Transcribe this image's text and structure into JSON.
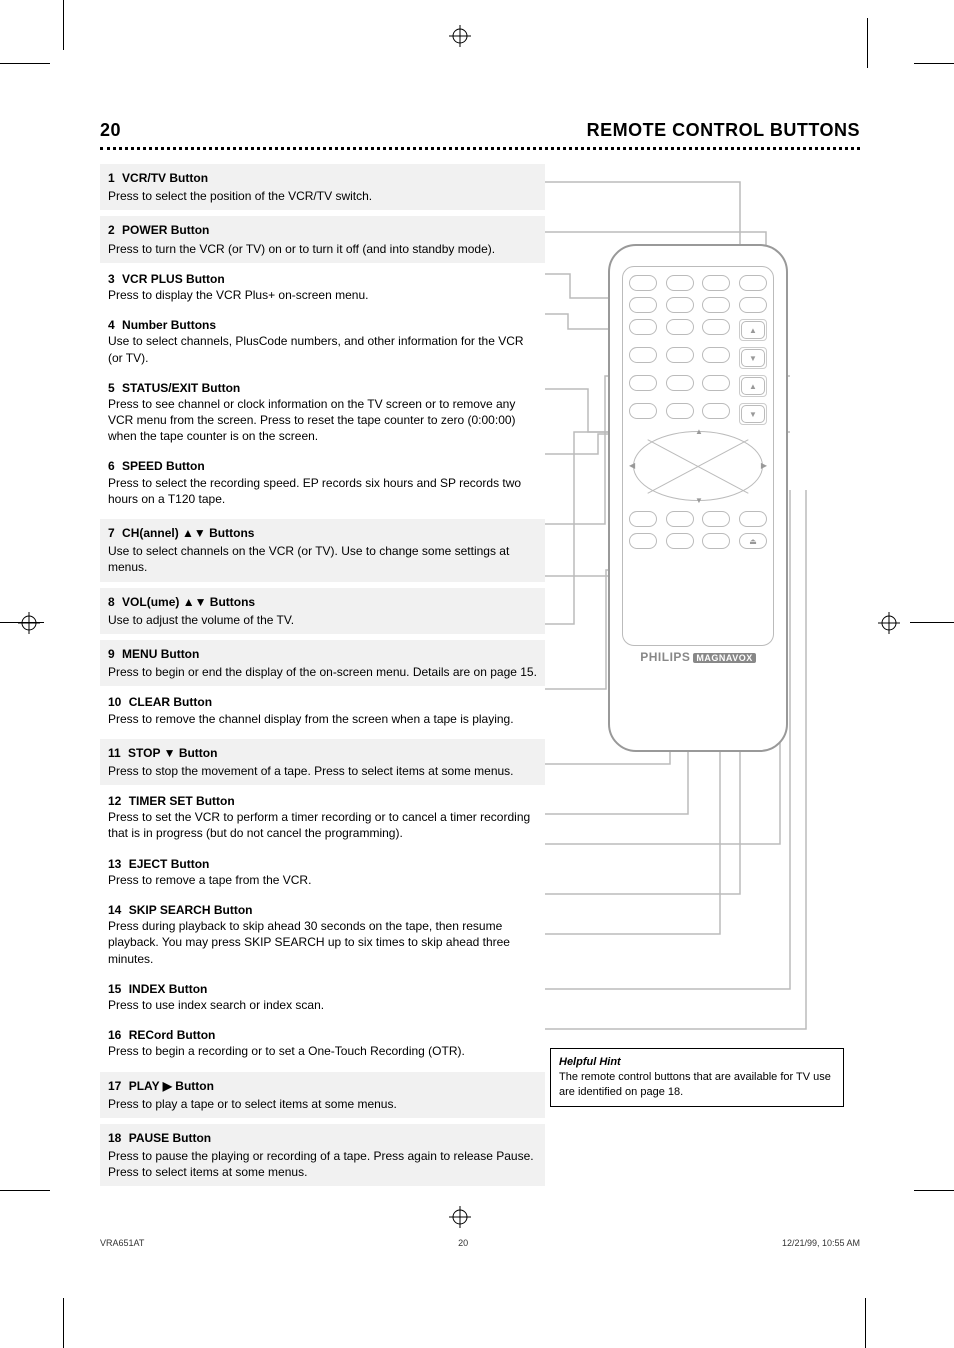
{
  "header": {
    "left": "20",
    "right": "REMOTE CONTROL BUTTONS"
  },
  "rows": [
    {
      "n": "1",
      "label": "VCR/TV Button",
      "desc": "Press to select the position of the VCR/TV switch."
    },
    {
      "n": "2",
      "label": "POWER Button",
      "desc": "Press to turn the VCR (or TV) on or to turn it off (and into standby mode)."
    },
    {
      "n": "3",
      "label": "VCR PLUS Button",
      "desc": "Press to display the VCR Plus+ on-screen menu."
    },
    {
      "n": "4",
      "label": "Number Buttons",
      "desc": "Use to select channels, PlusCode numbers, and other information for the VCR (or TV)."
    },
    {
      "n": "5",
      "label": "STATUS/EXIT Button",
      "desc": "Press to see channel or clock information on the TV screen or to remove any VCR menu from the screen. Press to reset the tape counter to zero (0:00:00) when the tape counter is on the screen."
    },
    {
      "n": "6",
      "label": "SPEED Button",
      "desc": "Press to select the recording speed. EP records six hours and SP records two hours on a T120 tape."
    },
    {
      "n": "7",
      "label": "CH(annel) ▲▼ Buttons",
      "desc": "Use to select channels on the VCR (or TV). Use to change some settings at menus."
    },
    {
      "n": "8",
      "label": "VOL(ume) ▲▼ Buttons",
      "desc": "Use to adjust the volume of the TV."
    },
    {
      "n": "9",
      "label": "MENU Button",
      "desc": "Press to begin or end the display of the on-screen menu. Details are on page 15."
    },
    {
      "n": "10",
      "label": "CLEAR Button",
      "desc": "Press to remove the channel display from the screen when a tape is playing."
    },
    {
      "n": "11",
      "label": "STOP ▼ Button",
      "desc": "Press to stop the movement of a tape. Press to select items at some menus."
    },
    {
      "n": "12",
      "label": "TIMER SET Button",
      "desc": "Press to set the VCR to perform a timer recording or to cancel a timer recording that is in progress (but do not cancel the programming)."
    },
    {
      "n": "13",
      "label": "EJECT Button",
      "desc": "Press to remove a tape from the VCR."
    },
    {
      "n": "14",
      "label": "SKIP SEARCH Button",
      "desc": "Press during playback to skip ahead 30 seconds on the tape, then resume playback. You may press SKIP SEARCH up to six times to skip ahead three minutes."
    },
    {
      "n": "15",
      "label": "INDEX Button",
      "desc": "Press to use index search or index scan."
    },
    {
      "n": "16",
      "label": "RECord Button",
      "desc": "Press to begin a recording or to set a One-Touch Recording (OTR)."
    },
    {
      "n": "17",
      "label": "PLAY ▶ Button",
      "desc": "Press to play a tape or to select items at some menus."
    },
    {
      "n": "18",
      "label": "PAUSE Button",
      "desc": "Press to pause the playing or recording of a tape. Press again to release Pause. Press to select items at some menus."
    }
  ],
  "note": {
    "title": "Helpful Hint",
    "body": "The remote control buttons that are available for TV use are identified on page 18."
  },
  "brand": {
    "name": "PHILIPS",
    "sub": "MAGNAVOX"
  },
  "footer": {
    "left": "VRA651AT",
    "right": "12/21/99, 10:55 AM",
    "page": "20"
  }
}
